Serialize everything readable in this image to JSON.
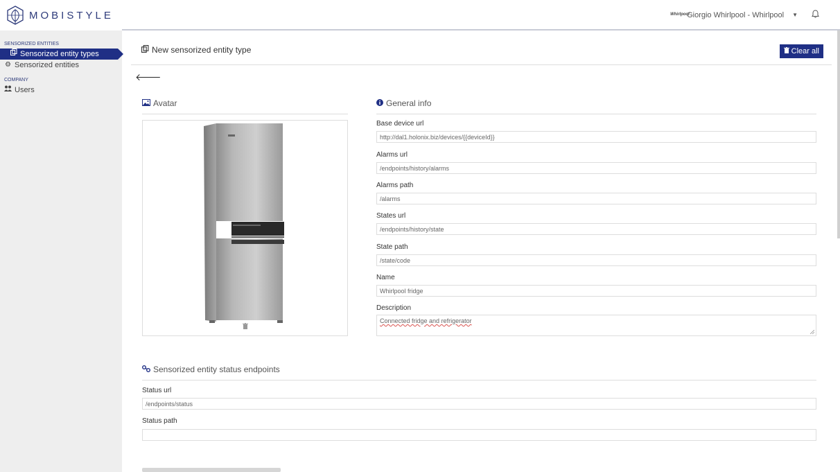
{
  "brand": {
    "logo_text": "MOBISTYLE"
  },
  "sidebar": {
    "sections": [
      {
        "title": "SENSORIZED ENTITIES"
      },
      {
        "title": "COMPANY"
      }
    ],
    "items": [
      {
        "label": "Sensorized entity types",
        "icon": "copy-icon",
        "active": true
      },
      {
        "label": "Sensorized entities",
        "icon": "cogs-icon"
      },
      {
        "label": "Users",
        "icon": "users-icon"
      }
    ]
  },
  "header": {
    "company_logo_text": "Whirlpool",
    "user_name": "Giorgio Whirlpool - Whirlpool",
    "icons": [
      "chevron-down-icon",
      "bell-icon"
    ]
  },
  "page": {
    "title": "New sensorized entity type",
    "clear_all_label": "Clear all",
    "back_icon": "arrow-left-icon"
  },
  "avatar": {
    "title": "Avatar",
    "icon": "image-icon"
  },
  "general_info": {
    "title": "General info",
    "icon": "info-circle-icon",
    "fields": [
      {
        "label": "Base device url",
        "value": "http://dal1.holonix.biz/devices/{{deviceId}}"
      },
      {
        "label": "Alarms url",
        "value": "/endpoints/history/alarms"
      },
      {
        "label": "Alarms path",
        "value": "/alarms"
      },
      {
        "label": "States url",
        "value": "/endpoints/history/state"
      },
      {
        "label": "State path",
        "value": "/state/code"
      },
      {
        "label": "Name",
        "value": "Whirlpool fridge"
      },
      {
        "label": "Description",
        "value": "Connected fridge and refrigerator"
      }
    ]
  },
  "status_endpoints": {
    "title": "Sensorized entity status endpoints",
    "icon": "link-icon",
    "fields": [
      {
        "label": "Status url",
        "value": "/endpoints/status"
      },
      {
        "label": "Status path",
        "value": ""
      }
    ]
  },
  "colors": {
    "accent": "#1f2f85",
    "sidebar_bg": "#eeeeee"
  }
}
